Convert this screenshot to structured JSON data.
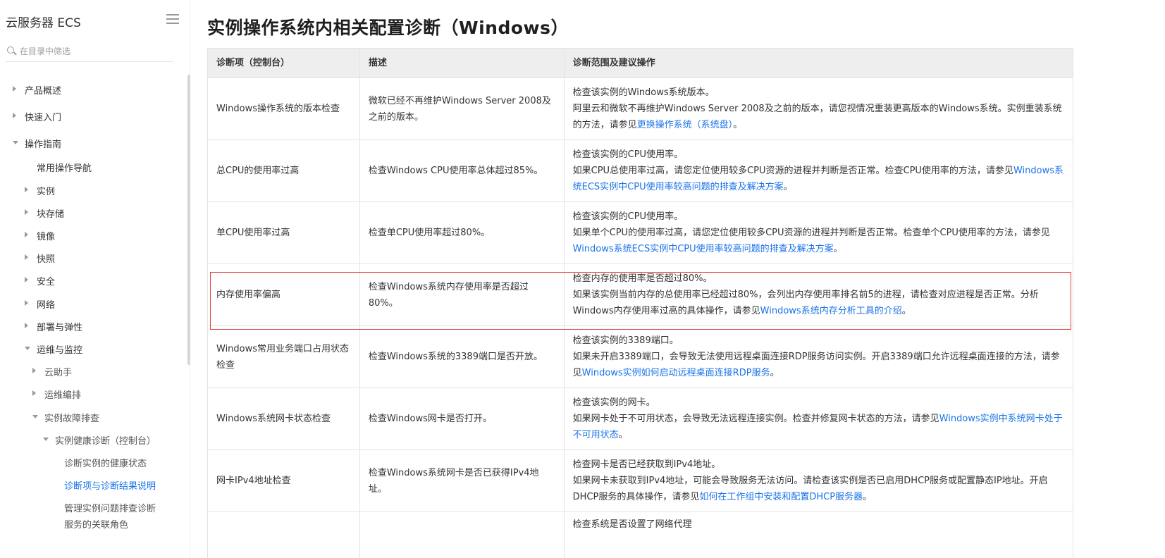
{
  "sidebar": {
    "title": "云服务器 ECS",
    "search_placeholder": "在目录中筛选",
    "items": [
      {
        "label": "产品概述"
      },
      {
        "label": "快速入门"
      },
      {
        "label": "操作指南"
      },
      {
        "label": "常用操作导航"
      },
      {
        "label": "实例"
      },
      {
        "label": "块存储"
      },
      {
        "label": "镜像"
      },
      {
        "label": "快照"
      },
      {
        "label": "安全"
      },
      {
        "label": "网络"
      },
      {
        "label": "部署与弹性"
      },
      {
        "label": "运维与监控"
      },
      {
        "label": "云助手"
      },
      {
        "label": "运维编排"
      },
      {
        "label": "实例故障排查"
      },
      {
        "label": "实例健康诊断（控制台）"
      },
      {
        "label": "诊断实例的健康状态"
      },
      {
        "label": "诊断项与诊断结果说明"
      },
      {
        "label": "管理实例问题排查诊断"
      },
      {
        "label": "服务的关联角色"
      }
    ]
  },
  "main": {
    "title": "实例操作系统内相关配置诊断（Windows）",
    "table": {
      "headers": [
        "诊断项（控制台）",
        "描述",
        "诊断范围及建议操作"
      ],
      "rows": [
        {
          "item": "Windows操作系统的版本检查",
          "desc": "微软已经不再维护Windows Server 2008及之前的版本。",
          "advice_l1": "检查该实例的Windows系统版本。",
          "advice_l2": "阿里云和微软不再维护Windows Server 2008及之前的版本，请您视情况重装更高版本的Windows系统。实例重装系统的方法，请参见",
          "link": "更换操作系统（系统盘）",
          "tail": "。"
        },
        {
          "item": "总CPU的使用率过高",
          "desc": "检查Windows CPU使用率总体超过85%。",
          "advice_l1": "检查该实例的CPU使用率。",
          "advice_l2": "如果CPU总使用率过高，请您定位使用较多CPU资源的进程并判断是否正常。检查CPU使用率的方法，请参见",
          "link": "Windows系统ECS实例中CPU使用率较高问题的排查及解决方案",
          "tail": "。"
        },
        {
          "item": "单CPU使用率过高",
          "desc": "检查单CPU使用率超过80%。",
          "advice_l1": "检查该实例的CPU使用率。",
          "advice_l2": "如果单个CPU的使用率过高，请您定位使用较多CPU资源的进程并判断是否正常。检查单个CPU使用率的方法，请参见",
          "link": "Windows系统ECS实例中CPU使用率较高问题的排查及解决方案",
          "tail": "。"
        },
        {
          "item": "内存使用率偏高",
          "desc": "检查Windows系统内存使用率是否超过80%。",
          "advice_l1": "检查内存的使用率是否超过80%。",
          "advice_l2": "如果该实例当前内存的总使用率已经超过80%，会列出内存使用率排名前5的进程，请检查对应进程是否正常。分析Windows内存使用率过高的具体操作，请参见",
          "link": "Windows系统内存分析工具的介绍",
          "tail": "。"
        },
        {
          "item": "Windows常用业务端口占用状态检查",
          "desc": "检查Windows系统的3389端口是否开放。",
          "advice_l1": "检查该实例的3389端口。",
          "advice_l2": "如果未开启3389端口，会导致无法使用远程桌面连接RDP服务访问实例。开启3389端口允许远程桌面连接的方法，请参见",
          "link": "Windows实例如何启动远程桌面连接RDP服务",
          "tail": "。"
        },
        {
          "item": "Windows系统网卡状态检查",
          "desc": "检查Windows网卡是否打开。",
          "advice_l1": "检查该实例的网卡。",
          "advice_l2": "如果网卡处于不可用状态，会导致无法远程连接实例。检查并修复网卡状态的方法，请参见",
          "link": "Windows实例中系统网卡处于不可用状态",
          "tail": "。"
        },
        {
          "item": "网卡IPv4地址检查",
          "desc": "检查Windows系统网卡是否已获得IPv4地址。",
          "advice_l1": "检查网卡是否已经获取到IPv4地址。",
          "advice_l2": "如果网卡未获取到IPv4地址，可能会导致服务无法访问。请检查该实例是否已启用DHCP服务或配置静态IP地址。开启DHCP服务的具体操作，请参见",
          "link": "如何在工作组中安装和配置DHCP服务器",
          "tail": "。"
        },
        {
          "item": "",
          "desc": "",
          "advice_l1": "检查系统是否设置了网络代理",
          "advice_l2": "",
          "link": "",
          "tail": ""
        }
      ]
    }
  },
  "colors": {
    "link": "#1a73e8",
    "highlight_border": "#e0443b",
    "header_bg": "#eeeeee"
  }
}
